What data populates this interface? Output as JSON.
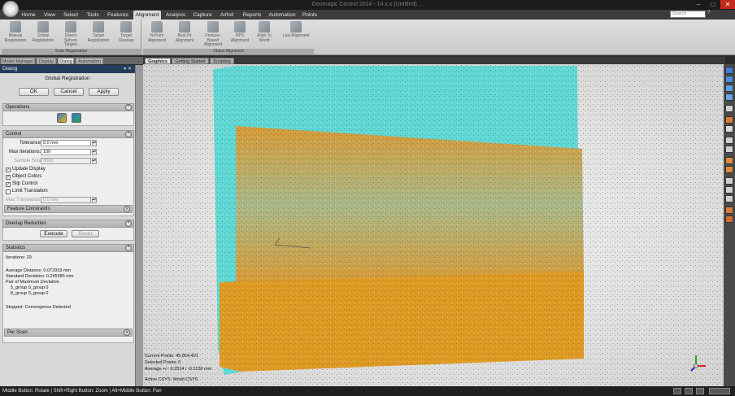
{
  "window": {
    "title": "Geomagic Control 2014 - 14.x.x (Untitled) ..."
  },
  "ribbon": {
    "tabs": [
      "Home",
      "View",
      "Select",
      "Tools",
      "Features",
      "Alignment",
      "Analysis",
      "Capture",
      "Airfoil",
      "Reports",
      "Automation",
      "Points"
    ],
    "active_tab": "Alignment",
    "search_placeholder": "Search",
    "groups": [
      {
        "label": "Scan Registration",
        "buttons": [
          {
            "label": "Manual Registration",
            "icon": "manual-registration-icon"
          },
          {
            "label": "Global Registration",
            "icon": "global-registration-icon"
          },
          {
            "label": "Detect Sphere Targets",
            "icon": "sphere-targets-icon"
          },
          {
            "label": "Target Registration",
            "icon": "target-registration-icon"
          },
          {
            "label": "Target Cleanup",
            "icon": "target-cleanup-icon"
          }
        ]
      },
      {
        "label": "Object Alignment",
        "buttons": [
          {
            "label": "N-Point Alignment",
            "icon": "n-point-alignment-icon"
          },
          {
            "label": "Best Fit Alignment",
            "icon": "best-fit-alignment-icon"
          },
          {
            "label": "Feature-Based Alignment",
            "icon": "feature-alignment-icon"
          },
          {
            "label": "RPS Alignment",
            "icon": "rps-alignment-icon"
          },
          {
            "label": "Align To World",
            "icon": "align-world-icon"
          },
          {
            "label": "Last Alignment",
            "icon": "last-alignment-icon"
          }
        ]
      }
    ]
  },
  "left_panel": {
    "tabs": [
      "Model Manager",
      "Display",
      "Dialog",
      "Automation"
    ],
    "active_tab": "Dialog",
    "header": "Dialog",
    "header_controls": "▾ ✕",
    "title": "Global Registration",
    "buttons": {
      "ok": "OK",
      "cancel": "Cancel",
      "apply": "Apply"
    },
    "operations": {
      "label": "Operations"
    },
    "control": {
      "label": "Control",
      "tolerance_label": "Tolerance:",
      "tolerance_value": "0.0 mm",
      "max_iterations_label": "Max Iterations:",
      "max_iterations_value": "100",
      "sample_size_label": "Sample Size:",
      "sample_size_value": "3000",
      "checks": [
        {
          "label": "Update Display",
          "checked": true
        },
        {
          "label": "Object Colors",
          "checked": true
        },
        {
          "label": "Slip Control",
          "checked": true
        },
        {
          "label": "Limit Translation",
          "checked": false
        }
      ],
      "max_translation_label": "Max Translation:",
      "max_translation_value": "0.0 mm",
      "feature_constraints_label": "Feature Constraints"
    },
    "overlap": {
      "label": "Overlap Reduction",
      "execute": "Execute",
      "reset": "Reset"
    },
    "statistics": {
      "label": "Statistics",
      "iterations": "Iterations: 29",
      "avg_distance": "Average Distance: 0.072919 mm",
      "std_dev": "Standard Deviation: 0.245585 mm",
      "pair_max": "Pair of Maximum Deviation",
      "pair_a": "5_group 0_group 0",
      "pair_b": "8_group 0_group 0",
      "stopped": "Stopped: Convergence Detected",
      "per_scan": "Per Scan"
    }
  },
  "viewport": {
    "tabs": [
      "Graphics",
      "Getting Started",
      "Scripting"
    ],
    "active_tab": "Graphics",
    "info": {
      "current_points": "Current Points: 45,854,401",
      "selected_points": "Selected Points: 0",
      "average": "Average +/-: 0.2514 / -0.2136 mm",
      "active_csys": "Active CSYS: World CSYS"
    },
    "colors": {
      "cyan": "#5fd8d6",
      "orange": "#df9a22",
      "bg": "#e6e6e6"
    }
  },
  "status_bar": {
    "text": "Middle Button: Rotate | Shift+Right Button: Zoom | Alt+Middle Button: Pan"
  }
}
